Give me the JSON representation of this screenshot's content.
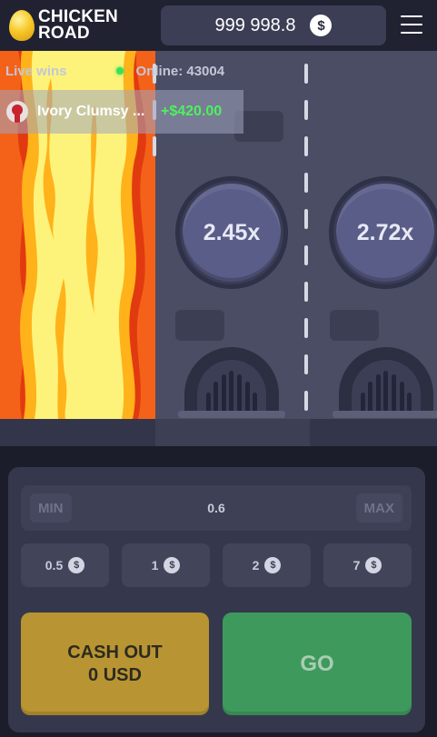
{
  "header": {
    "logo_line1": "CHICKEN",
    "logo_line2": "ROAD",
    "balance": "999 998.8",
    "currency_symbol": "$"
  },
  "stats": {
    "live_wins_label": "Live wins",
    "online_label": "Online: 43004"
  },
  "last_win": {
    "player": "Ivory Clumsy ...",
    "amount": "+$420.00"
  },
  "lanes": [
    {
      "multiplier": "2.45x"
    },
    {
      "multiplier": "2.72x"
    }
  ],
  "bet": {
    "min_label": "MIN",
    "max_label": "MAX",
    "value": "0.6",
    "presets": [
      "0.5",
      "1",
      "2",
      "7"
    ]
  },
  "actions": {
    "cashout_line1": "CASH OUT",
    "cashout_line2": "0 USD",
    "go_label": "GO"
  },
  "colors": {
    "background": "#1c1d2b",
    "road": "#4a4d64",
    "cashout": "#b89532",
    "go": "#3e9a5c",
    "win_amount": "#4cf25e",
    "online_dot": "#39e05b"
  }
}
